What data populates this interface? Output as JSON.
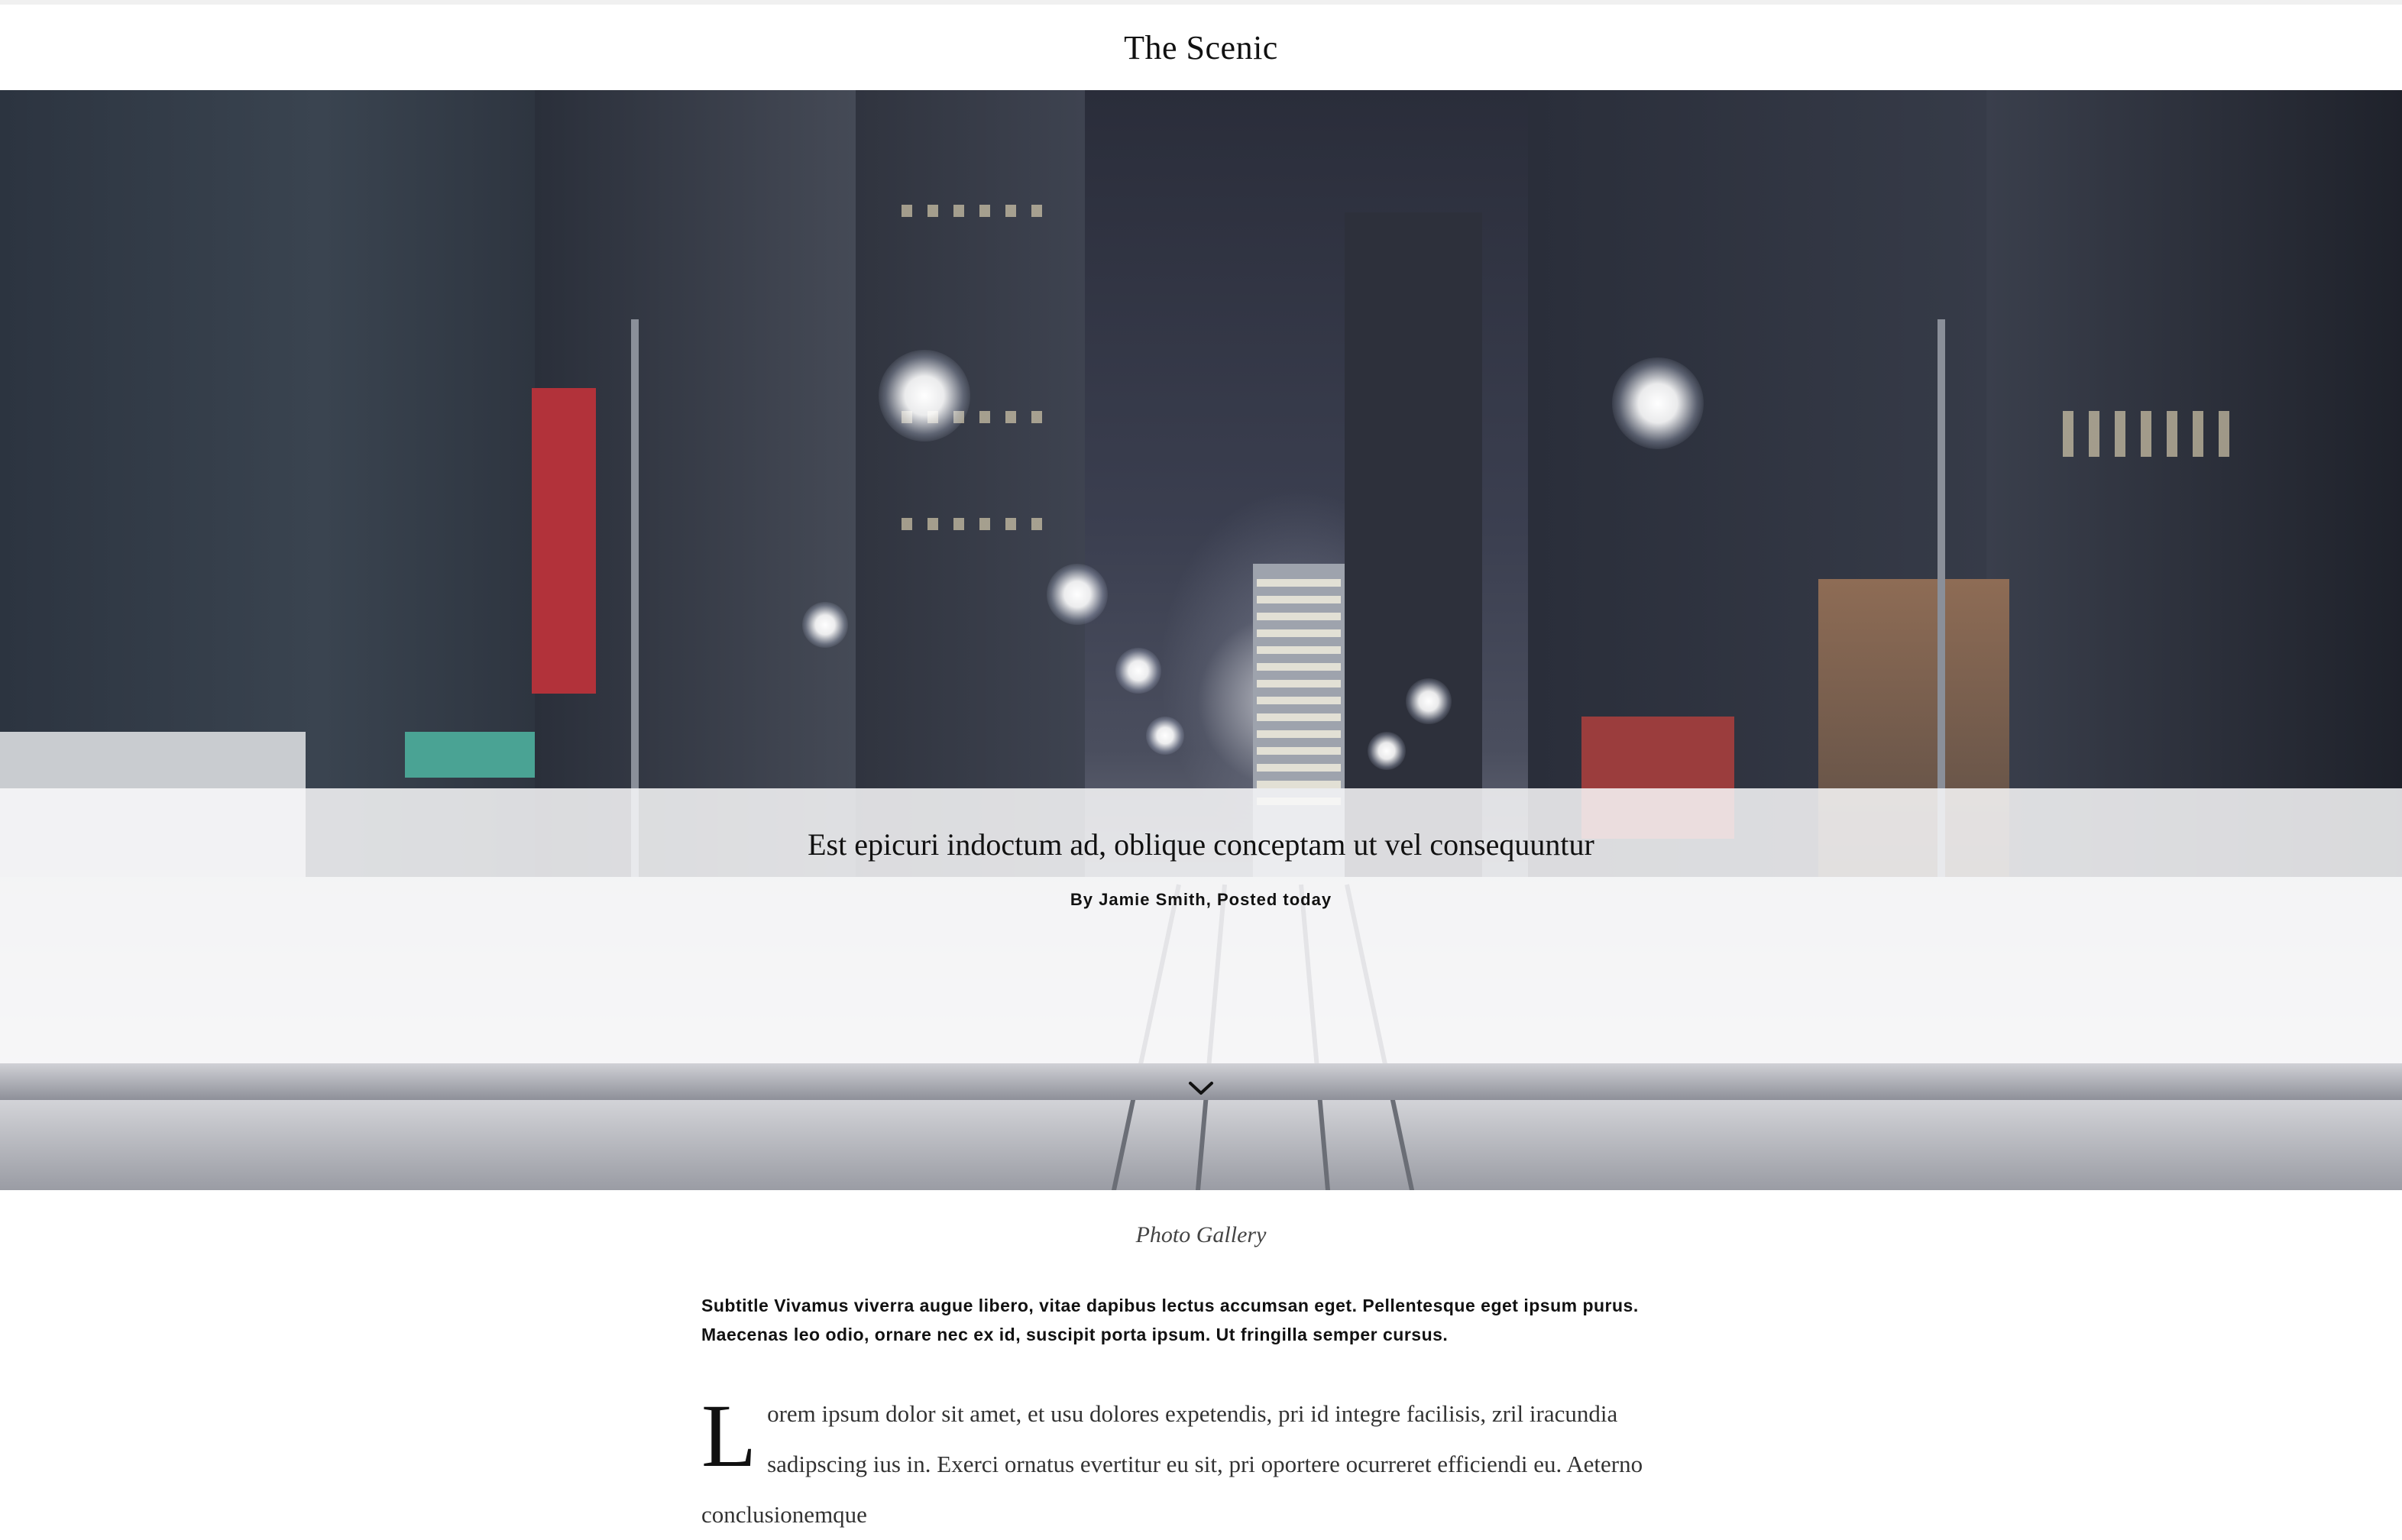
{
  "header": {
    "site_title": "The Scenic"
  },
  "hero": {
    "headline": "Est epicuri indoctum ad, oblique conceptam ut vel consequuntur",
    "byline": "By Jamie Smith, Posted today",
    "scroll_icon": "chevron-down-icon"
  },
  "article": {
    "caption": "Photo Gallery",
    "subtitle": "Subtitle Vivamus viverra augue libero, vitae dapibus lectus accumsan eget. Pellentesque eget ipsum purus. Maecenas leo odio, ornare nec ex id, suscipit porta ipsum. Ut fringilla semper cursus.",
    "dropcap": "L",
    "body": "orem ipsum dolor sit amet, et usu dolores expetendis, pri id integre facilisis, zril iracundia sadipscing ius in. Exerci ornatus evertitur eu sit, pri oportere ocurreret efficiendi eu. Aeterno conclusionemque"
  }
}
